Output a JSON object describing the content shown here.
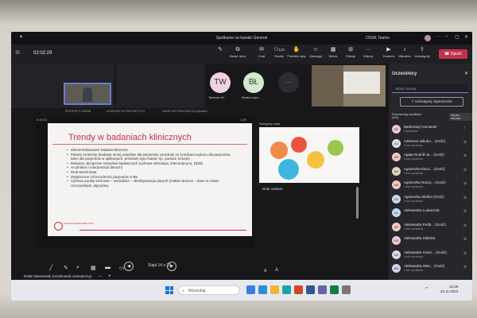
{
  "window": {
    "title": "Spotkanie na kanale General",
    "org": "OSSK Teams",
    "avatar_initials": "JH"
  },
  "toolbar": {
    "timer": "02:02:29",
    "buttons": [
      {
        "label": "",
        "icon": "pen-icon"
      },
      {
        "label": "Nowe okno",
        "icon": "new-window-icon"
      },
      {
        "label": "Czat",
        "icon": "chat-icon"
      },
      {
        "label": "Osoby",
        "icon": "people-icon",
        "count": "110"
      },
      {
        "label": "Podnieś rękę",
        "icon": "raise-hand-icon"
      },
      {
        "label": "Zareaguj",
        "icon": "react-icon"
      },
      {
        "label": "Widok",
        "icon": "view-icon"
      },
      {
        "label": "Pokoje",
        "icon": "rooms-icon"
      },
      {
        "label": "Więcej",
        "icon": "more-icon"
      },
      {
        "label": "Kamera",
        "icon": "camera-icon"
      },
      {
        "label": "Mikrofon",
        "icon": "mic-icon"
      },
      {
        "label": "Udostępnij",
        "icon": "share-icon"
      }
    ],
    "leave": "Opuść"
  },
  "stage": {
    "pin_labels": [
      "PRZYPIĘTY ZASÓB",
      "UCISZONY W PRZYPIĘTYCH",
      "ZAKRYCIE PODCZAS OGLĄDANIA"
    ],
    "avatars": [
      {
        "initials": "TW",
        "name": "Tadeusz W...",
        "color": "#f0d2e0"
      },
      {
        "initials": "BŁ",
        "name": "Beata Łopa...",
        "color": "#d4e8cf"
      }
    ]
  },
  "presentation": {
    "elapsed": "0:19:31",
    "duration": "1:09",
    "title": "Trendy w badaniach klinicznych",
    "bullets": [
      "Zdecentralizowane badania kliniczne",
      "Patient Centricity (badania mniej uciążliwe dla pacjentów, protokoły ze ścieżkami wyboru dla pacjentów, dane dla pacjentów w aplikacjach, protokoły typu master np. parasol, koszyk)",
      "Mniejsze obciążenie zespołów badawczych (cyfrowa rekrutacja, telemedycyna, EDM)",
      "AI (analiza i interpretacja danych)",
      "Real-World Data",
      "Zwiększone różnorodności pacjentów w BK",
      "Cyfrowe punkty końcowe – wearables – obiektywizacja danych (mobile devices – dane w czasie rzeczywistym, algorytmy"
    ],
    "logo_text": "POLSKA AKADEMIA MEDYCZNA",
    "slide_counter": "Slajd 14 z 28",
    "presenter": "Rafał Staszewski (Użytkownik zewnętrzny)",
    "next_label": "Następny slajd",
    "notes": "Brak notatek."
  },
  "participants": {
    "header": "Uczestnicy",
    "search_placeholder": "Wpisz nazwę",
    "invite_button": "Udostępnij zaproszenie",
    "section_line1": "Podczas tego spotkania",
    "section_line2": "(110)",
    "mute_all": "Wycisz wszystk...",
    "list": [
      {
        "initials": "BF",
        "name": "Bartłomiej Furmanek",
        "role": "Organizator",
        "color": "#e8c6d8"
      },
      {
        "initials": "AJ",
        "name": "Adrianna Jakubo... (Gość)",
        "role": "Gość spotkania",
        "color": "#d8dbe6"
      },
      {
        "initials": "AR",
        "name": "Agata Rudolf-Ja... (Gość)",
        "role": "Gość spotkania",
        "color": "#f2c9c0"
      },
      {
        "initials": "AK",
        "name": "Agnieszka Klucz... (Gość)",
        "role": "Gość spotkania",
        "color": "#e4d3c2"
      },
      {
        "initials": "AR",
        "name": "Agnieszka Raszy... (Gość)",
        "role": "Gość spotkania",
        "color": "#f2c9c0"
      },
      {
        "initials": "AS",
        "name": "Agnieszka Stańko (Gość)",
        "role": "Gość spotkania",
        "color": "#c9d9ea"
      },
      {
        "initials": "AL",
        "name": "Aleksandra Ludwiczak",
        "role": "",
        "color": "#c8d6ef"
      },
      {
        "initials": "AP",
        "name": "Aleksandra Podb... (Gość)",
        "role": "Gość spotkania",
        "color": "#f2c9c0"
      },
      {
        "initials": "AS",
        "name": "Aleksandra Sibilska",
        "role": "",
        "color": "#f0c7d5"
      },
      {
        "initials": "AS",
        "name": "Aleksandra Szarz... (Gość)",
        "role": "Gość spotkania",
        "color": "#d3dbe8"
      },
      {
        "initials": "AW",
        "name": "Aleksandra Wier... (Gość)",
        "role": "Gość spotkania",
        "color": "#d6d0ea"
      }
    ]
  },
  "taskbar": {
    "search_placeholder": "Wyszukaj",
    "time": "11:09",
    "date": "22.11.2023",
    "app_colors": [
      "#3b7be0",
      "#2b8fd8",
      "#f2b431",
      "#1fa2a8",
      "#d24726",
      "#2b5797",
      "#6264a7",
      "#107c41",
      "#7a7574"
    ]
  },
  "colors": {
    "accent": "#6264a7",
    "leave": "#c4314b",
    "slide_title": "#c4314b"
  }
}
